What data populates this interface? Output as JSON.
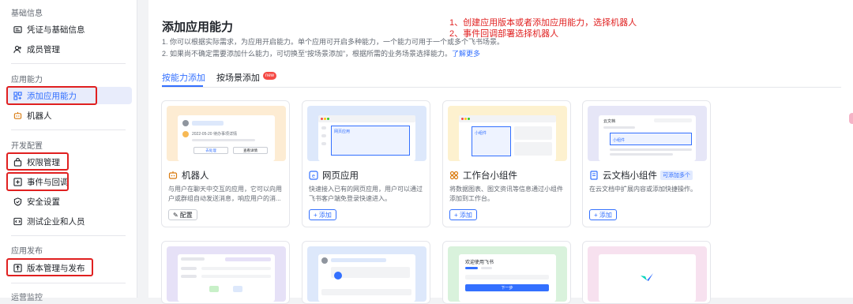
{
  "sidebar": {
    "sections": [
      "基础信息",
      "应用能力",
      "开发配置",
      "应用发布",
      "运营监控"
    ],
    "items": [
      {
        "label": "凭证与基础信息",
        "icon": "credential-icon"
      },
      {
        "label": "成员管理",
        "icon": "member-icon"
      },
      {
        "label": "添加应用能力",
        "icon": "add-capability-icon",
        "active": true
      },
      {
        "label": "机器人",
        "icon": "robot-icon"
      },
      {
        "label": "权限管理",
        "icon": "permission-icon"
      },
      {
        "label": "事件与回调",
        "icon": "event-icon"
      },
      {
        "label": "安全设置",
        "icon": "shield-icon"
      },
      {
        "label": "测试企业和人员",
        "icon": "test-icon"
      },
      {
        "label": "版本管理与发布",
        "icon": "publish-icon"
      }
    ]
  },
  "header": {
    "title": "添加应用能力",
    "desc1": "1. 你可以根据实际需求，为应用开启能力。单个应用可开启多种能力，一个能力可用于一个或多个飞书场景。",
    "desc2": "2. 如果尚不确定需要添加什么能力，可切换至“按场景添加”，根据所需的业务场景选择能力。",
    "learn_more": "了解更多"
  },
  "annotations": {
    "line1": "1、创建应用版本或者添加应用能力，选择机器人",
    "line2": "2、事件回调部署选择机器人"
  },
  "tabs": [
    {
      "label": "按能力添加",
      "active": true
    },
    {
      "label": "按场景添加",
      "badge": "new"
    }
  ],
  "cards": [
    {
      "title": "机器人",
      "icon": "robot-icon",
      "desc": "与用户在聊天中交互的应用，它可以向用户或群组自动发送消息，响应用户的消...",
      "button": "配置",
      "preview_color": "#fdecd3"
    },
    {
      "title": "网页应用",
      "icon": "web-icon",
      "desc": "快速接入已有的网页应用，用户可以通过飞书客户端免登录快速进入。",
      "button": "+ 添加",
      "preview_color": "#dde8fb"
    },
    {
      "title": "工作台小组件",
      "icon": "widget-icon",
      "desc": "将数据图表、图文资讯等信息通过小组件添加到工作台。",
      "button": "+ 添加",
      "preview_color": "#fdf1cf"
    },
    {
      "title": "云文档小组件",
      "icon": "doc-icon",
      "badge": "可添加多个",
      "desc": "在云文档中扩展内容或添加快捷操作。",
      "button": "+ 添加",
      "preview_color": "#e6e6f7"
    }
  ],
  "preview_texts": {
    "robot_date": "2022-05-20 待办事项详情",
    "robot_btn1": "去处理",
    "robot_btn2": "查看详情",
    "doc_title": "云文档",
    "doc_item": "小组件",
    "widget_item": "小组件",
    "web_item": "网页应用",
    "welcome": "欢迎使用飞书",
    "next_btn": "下一步"
  },
  "colors": {
    "accent": "#3370ff",
    "annotation_red": "#e02020"
  }
}
